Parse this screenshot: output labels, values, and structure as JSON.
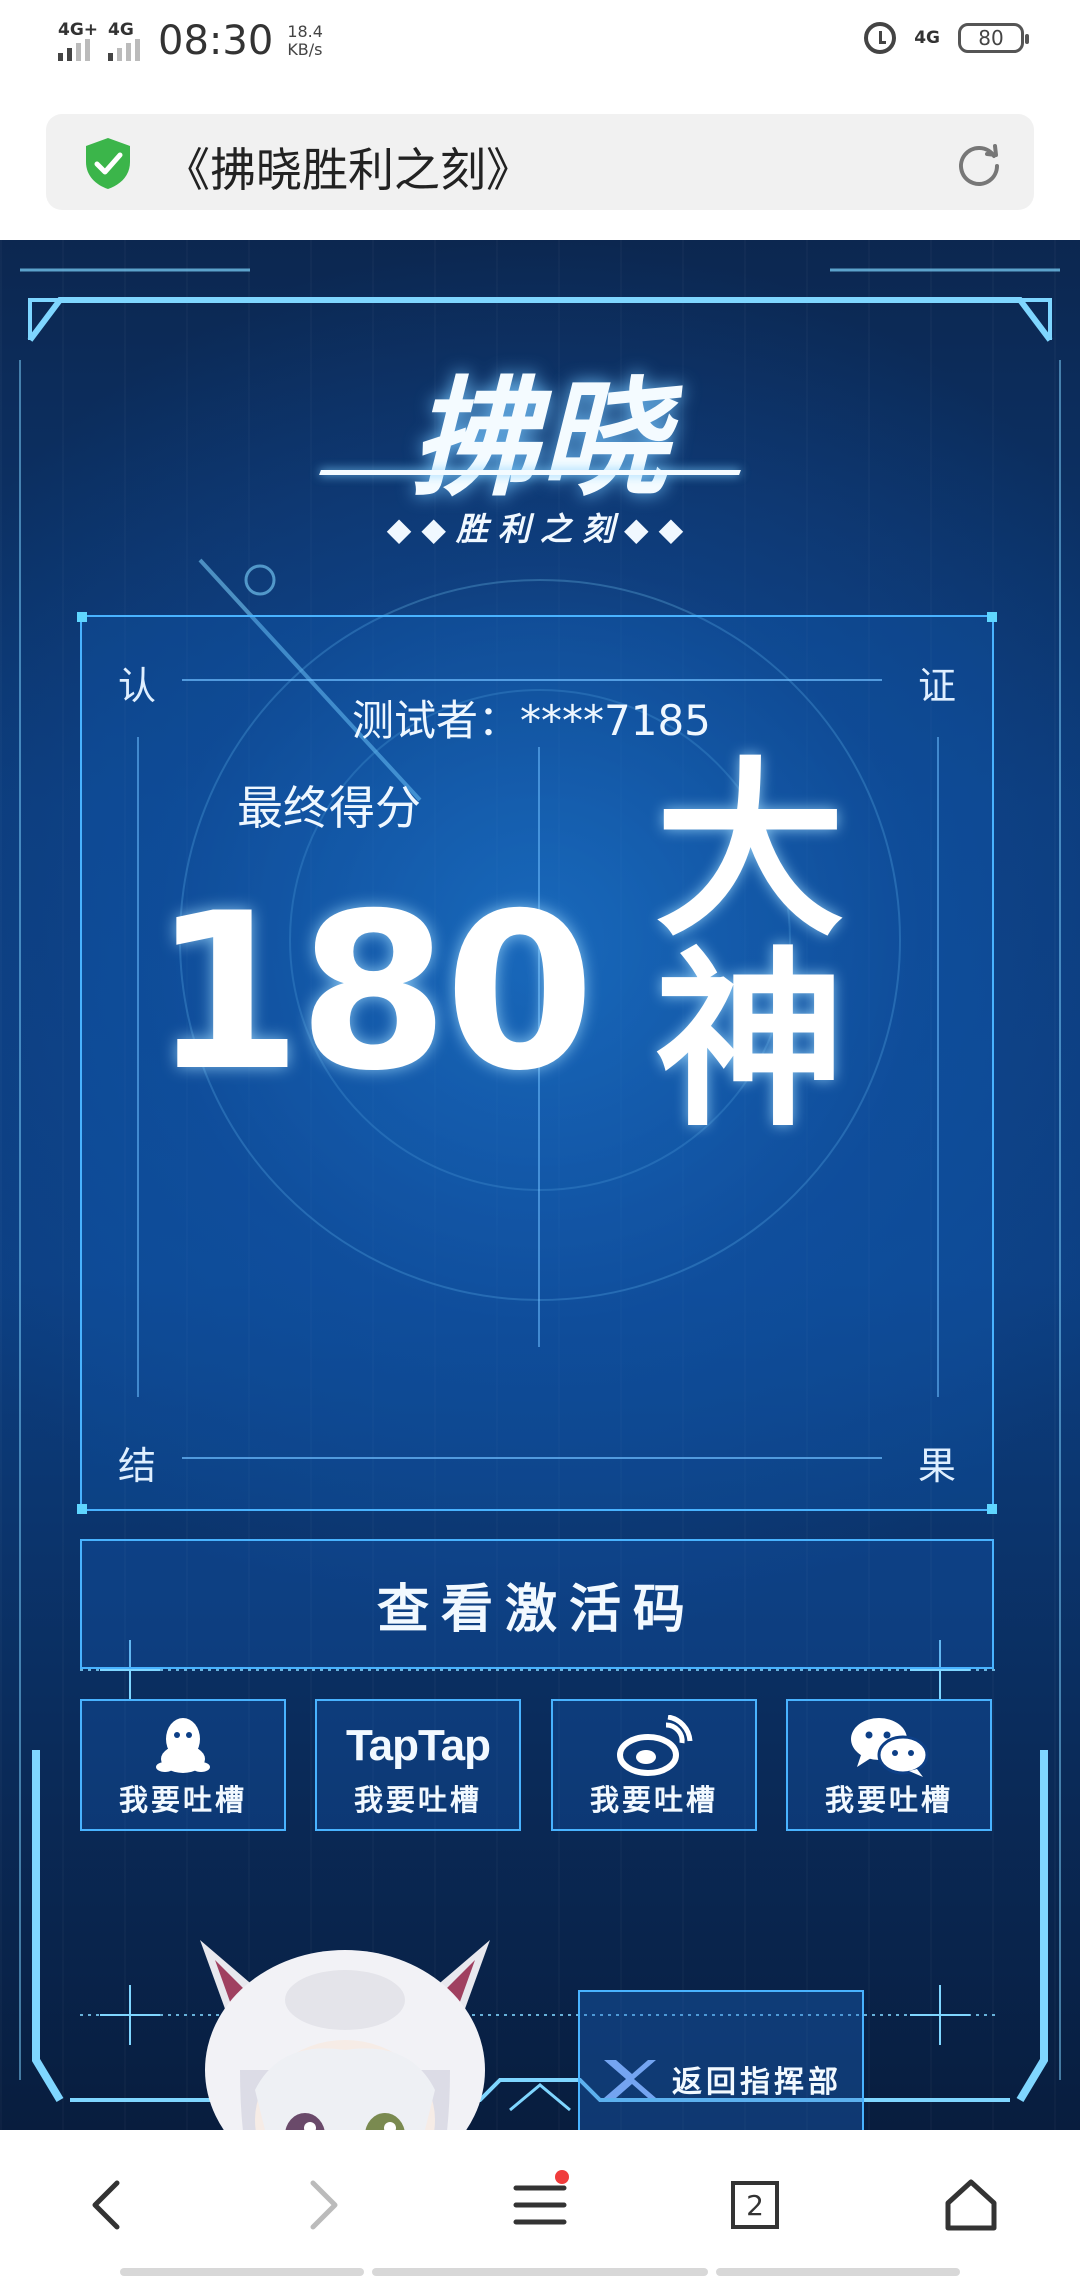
{
  "status_bar": {
    "net1": "4G+",
    "net2": "4G",
    "time": "08:30",
    "speed_value": "18.4",
    "speed_unit": "KB/s",
    "net_right": "4G",
    "battery": "80"
  },
  "address_bar": {
    "title": "《拂晓胜利之刻》"
  },
  "logo": {
    "main": "拂晓",
    "sub": "◆◆胜利之刻◆◆"
  },
  "result_panel": {
    "corner_tl": "认",
    "corner_tr": "证",
    "corner_bl": "结",
    "corner_br": "果",
    "tester_label": "测试者：",
    "tester_id": "****7185",
    "score_label": "最终得分",
    "score": "180",
    "rank_line1": "大",
    "rank_line2": "神"
  },
  "activate_button": {
    "label": "查看激活码"
  },
  "share_buttons": [
    {
      "icon": "qq-icon",
      "label": "我要吐槽"
    },
    {
      "icon": "taptap-logo",
      "text": "TapTap",
      "label": "我要吐槽"
    },
    {
      "icon": "weibo-icon",
      "label": "我要吐槽"
    },
    {
      "icon": "wechat-icon",
      "label": "我要吐槽"
    }
  ],
  "hq_button": {
    "label": "返回指挥部"
  },
  "nav": {
    "tab_count": "2"
  },
  "colors": {
    "accent": "#49b3ff",
    "page_bg": "#0b3a78",
    "secure_green": "#3bb54a",
    "notification": "#f03c3c"
  }
}
